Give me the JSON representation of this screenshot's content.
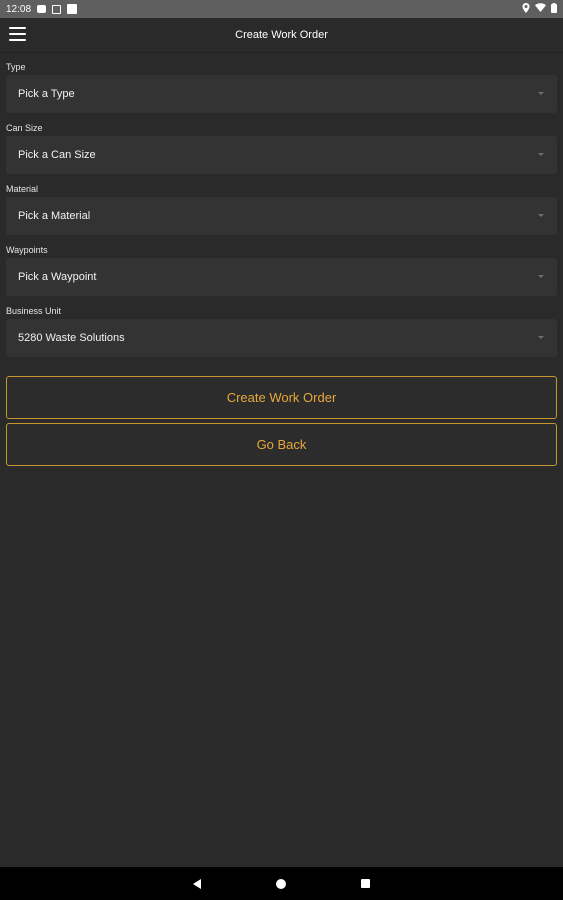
{
  "status_bar": {
    "time": "12:08",
    "left_icons": [
      "message-icon",
      "calendar-icon",
      "notification-box-icon"
    ],
    "right_icons": [
      "location-icon",
      "wifi-icon",
      "battery-icon"
    ]
  },
  "app_bar": {
    "title": "Create Work Order",
    "menu_icon": "hamburger-menu-icon"
  },
  "form": {
    "fields": [
      {
        "label": "Type",
        "value": "Pick a Type"
      },
      {
        "label": "Can Size",
        "value": "Pick a Can Size"
      },
      {
        "label": "Material",
        "value": "Pick a Material"
      },
      {
        "label": "Waypoints",
        "value": "Pick a Waypoint"
      },
      {
        "label": "Business Unit",
        "value": "5280 Waste Solutions"
      }
    ]
  },
  "buttons": {
    "create_label": "Create Work Order",
    "back_label": "Go Back"
  },
  "nav_bar": {
    "icons": [
      "back-triangle-icon",
      "home-circle-icon",
      "recents-square-icon"
    ]
  },
  "colors": {
    "background": "#2a2a2a",
    "field_background": "#333333",
    "accent": "#e7a83a",
    "status_bar": "#5f5f5f",
    "nav_bar": "#000000"
  }
}
